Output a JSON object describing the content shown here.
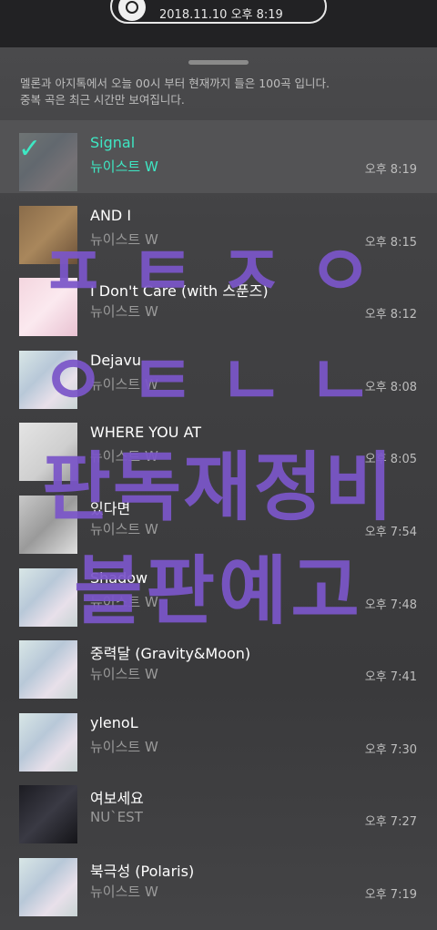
{
  "header": {
    "datetime": "2018.11.10 오후 8:19",
    "disc_icon": "music-disc-icon"
  },
  "notice": {
    "line1": "멜론과 아지톡에서 오늘 00시 부터 현재까지 들은 100곡 입니다.",
    "line2": "중복 곡은 최근 시간만 보여집니다."
  },
  "songs": [
    {
      "title": "Signal",
      "artist": "뉴이스트 W",
      "time": "오후 8:19",
      "active": true
    },
    {
      "title": "AND I",
      "artist": "뉴이스트 W",
      "time": "오후 8:15"
    },
    {
      "title": "I Don't Care (with 스푼즈)",
      "artist": "뉴이스트 W",
      "time": "오후 8:12"
    },
    {
      "title": "Dejavu",
      "artist": "뉴이스트 W",
      "time": "오후 8:08"
    },
    {
      "title": "WHERE YOU AT",
      "artist": "뉴이스트 W",
      "time": "오후 8:05"
    },
    {
      "title": "있다면",
      "artist": "뉴이스트 W",
      "time": "오후 7:54"
    },
    {
      "title": "Shadow",
      "artist": "뉴이스트 W",
      "time": "오후 7:48"
    },
    {
      "title": "중력달 (Gravity&Moon)",
      "artist": "뉴이스트 W",
      "time": "오후 7:41"
    },
    {
      "title": "ylenoL",
      "artist": "뉴이스트 W",
      "time": "오후 7:30"
    },
    {
      "title": "여보세요",
      "artist": "NU`EST",
      "time": "오후 7:27"
    },
    {
      "title": "북극성 (Polaris)",
      "artist": "뉴이스트 W",
      "time": "오후 7:19"
    }
  ],
  "overlay": {
    "line1": "ㅍㅌㅈㅇ",
    "line2": "ㅇㅌㄴㄴ",
    "line3": "판독재정비",
    "line4": "블판예고"
  },
  "colors": {
    "accent": "#3ee8c4",
    "overlay": "#7b56c9"
  }
}
